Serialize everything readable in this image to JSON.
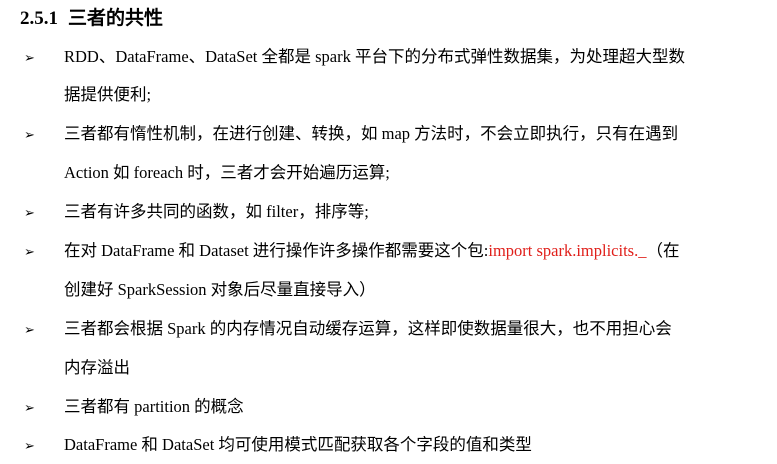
{
  "section": {
    "number": "2.5.1",
    "title": "三者的共性"
  },
  "bullet_glyph": "➢",
  "accent_color": "#e0201b",
  "items": [
    {
      "line1": "RDD、DataFrame、DataSet 全都是 spark 平台下的分布式弹性数据集，为处理超大型数",
      "line2": "据提供便利;"
    },
    {
      "line1": "三者都有惰性机制，在进行创建、转换，如 map 方法时，不会立即执行，只有在遇到",
      "line2": "Action 如 foreach 时，三者才会开始遍历运算;"
    },
    {
      "line1": "三者有许多共同的函数，如 filter，排序等;"
    },
    {
      "line1_before": "在对 DataFrame 和 Dataset 进行操作许多操作都需要这个包:",
      "line1_code": "import spark.implicits._",
      "line1_after": "（在",
      "line2": "创建好 SparkSession 对象后尽量直接导入）"
    },
    {
      "line1": "三者都会根据  Spark  的内存情况自动缓存运算，这样即使数据量很大，也不用担心会",
      "line2": "内存溢出"
    },
    {
      "line1": "三者都有 partition 的概念"
    },
    {
      "line1": "DataFrame 和 DataSet 均可使用模式匹配获取各个字段的值和类型"
    }
  ]
}
